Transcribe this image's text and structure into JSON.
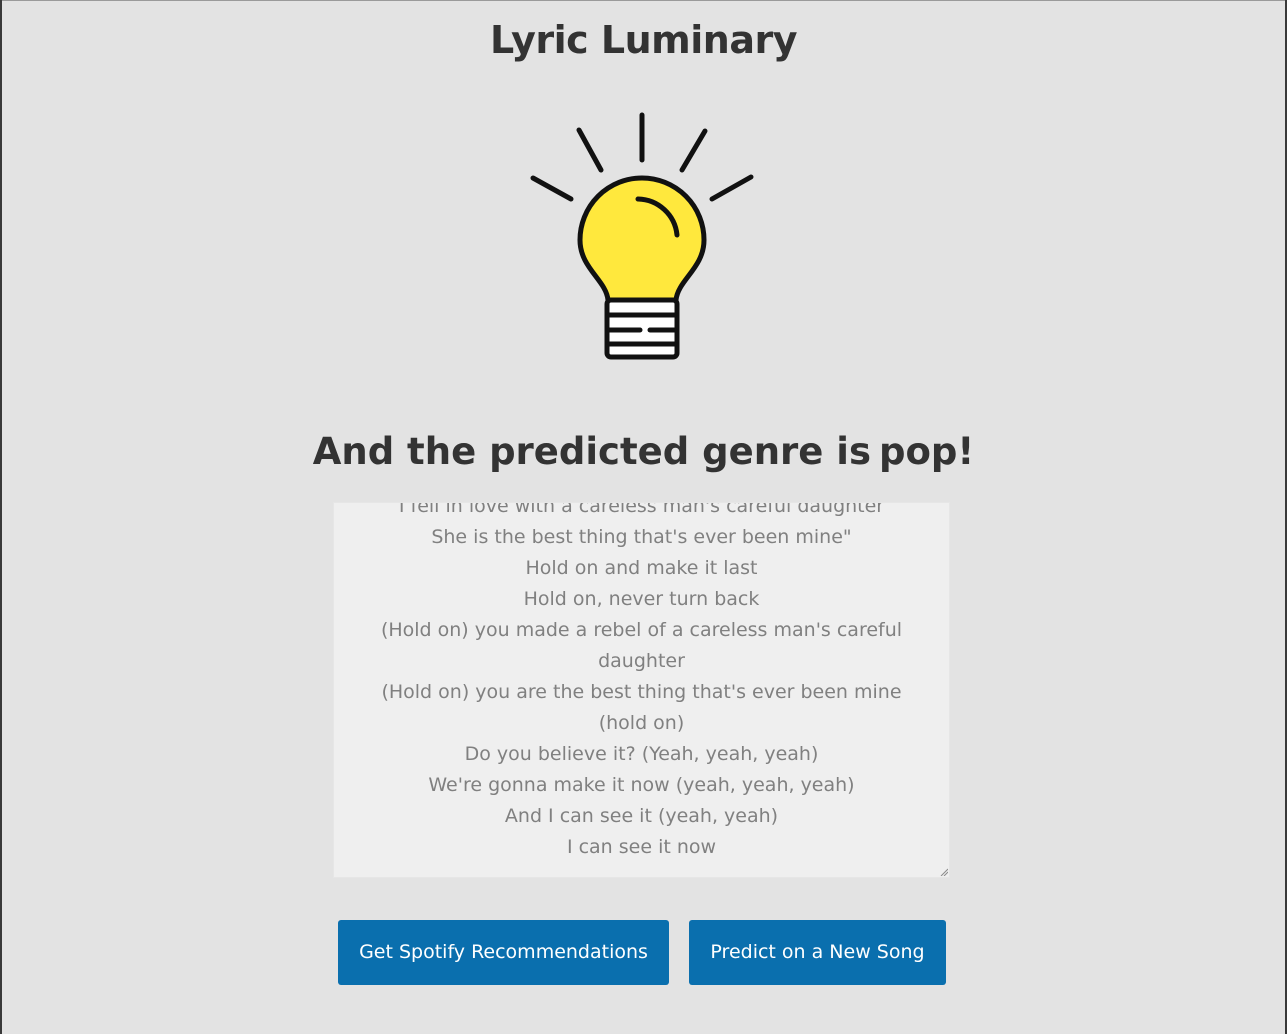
{
  "app": {
    "title": "Lyric Luminary"
  },
  "result": {
    "prefix": "And the predicted genre is",
    "genre": "pop",
    "suffix": "!"
  },
  "lyrics": {
    "lines": [
      "I fell in love with a careless man's careful daughter",
      "She is the best thing that's ever been mine\"",
      "Hold on and make it last",
      "Hold on, never turn back",
      "(Hold on) you made a rebel of a careless man's careful daughter",
      "(Hold on) you are the best thing that's ever been mine (hold on)",
      "Do you believe it? (Yeah, yeah, yeah)",
      "We're gonna make it now (yeah, yeah, yeah)",
      "And I can see it (yeah, yeah)",
      "I can see it now"
    ]
  },
  "buttons": {
    "spotify_label": "Get Spotify Recommendations",
    "new_song_label": "Predict on a New Song"
  },
  "icons": {
    "hero": "lightbulb-icon",
    "resize": "resize-grip-icon"
  },
  "colors": {
    "background": "#e3e3e3",
    "button": "#0a6fae",
    "bulb_fill": "#ffe83d",
    "text": "#333333",
    "lyrics_text": "#808080"
  }
}
